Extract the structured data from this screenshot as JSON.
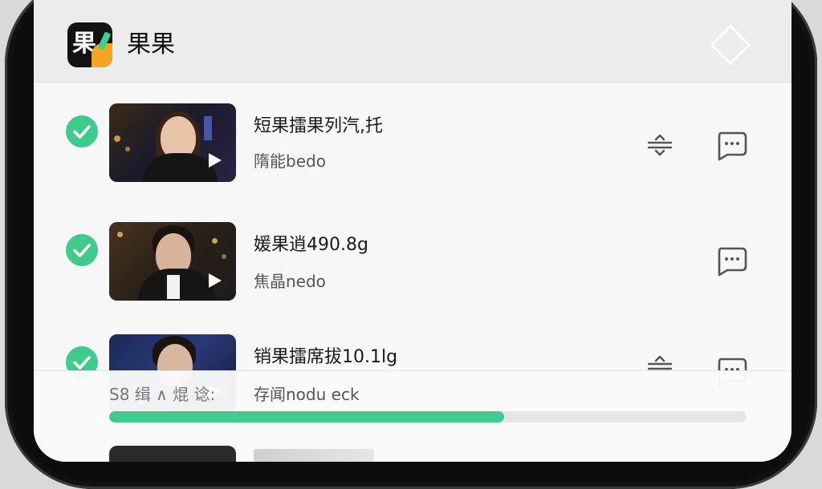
{
  "app": {
    "logo_text": "果",
    "title": "果果"
  },
  "colors": {
    "accent_green": "#3ecb8c",
    "logo_orange": "#f4a623"
  },
  "items": [
    {
      "title": "短果擂果列汽,托",
      "subtitle": "隋能bedo",
      "checked": true,
      "icons": [
        "check-icon",
        "play-icon",
        "sort-icon",
        "chat-icon"
      ]
    },
    {
      "title": "媛果逍490.8g",
      "subtitle": "焦晶nedo",
      "checked": true,
      "icons": [
        "check-icon",
        "play-icon",
        "chat-icon"
      ]
    },
    {
      "title": "销果擂席拔10.1lg",
      "subtitle": "",
      "checked": true,
      "icons": [
        "check-icon",
        "play-icon",
        "sort-icon",
        "chat-icon"
      ]
    }
  ],
  "progress": {
    "label": "S8 缉 ∧ 焜 谂:",
    "detail": "存闻nodu eck",
    "fraction": 0.62
  }
}
